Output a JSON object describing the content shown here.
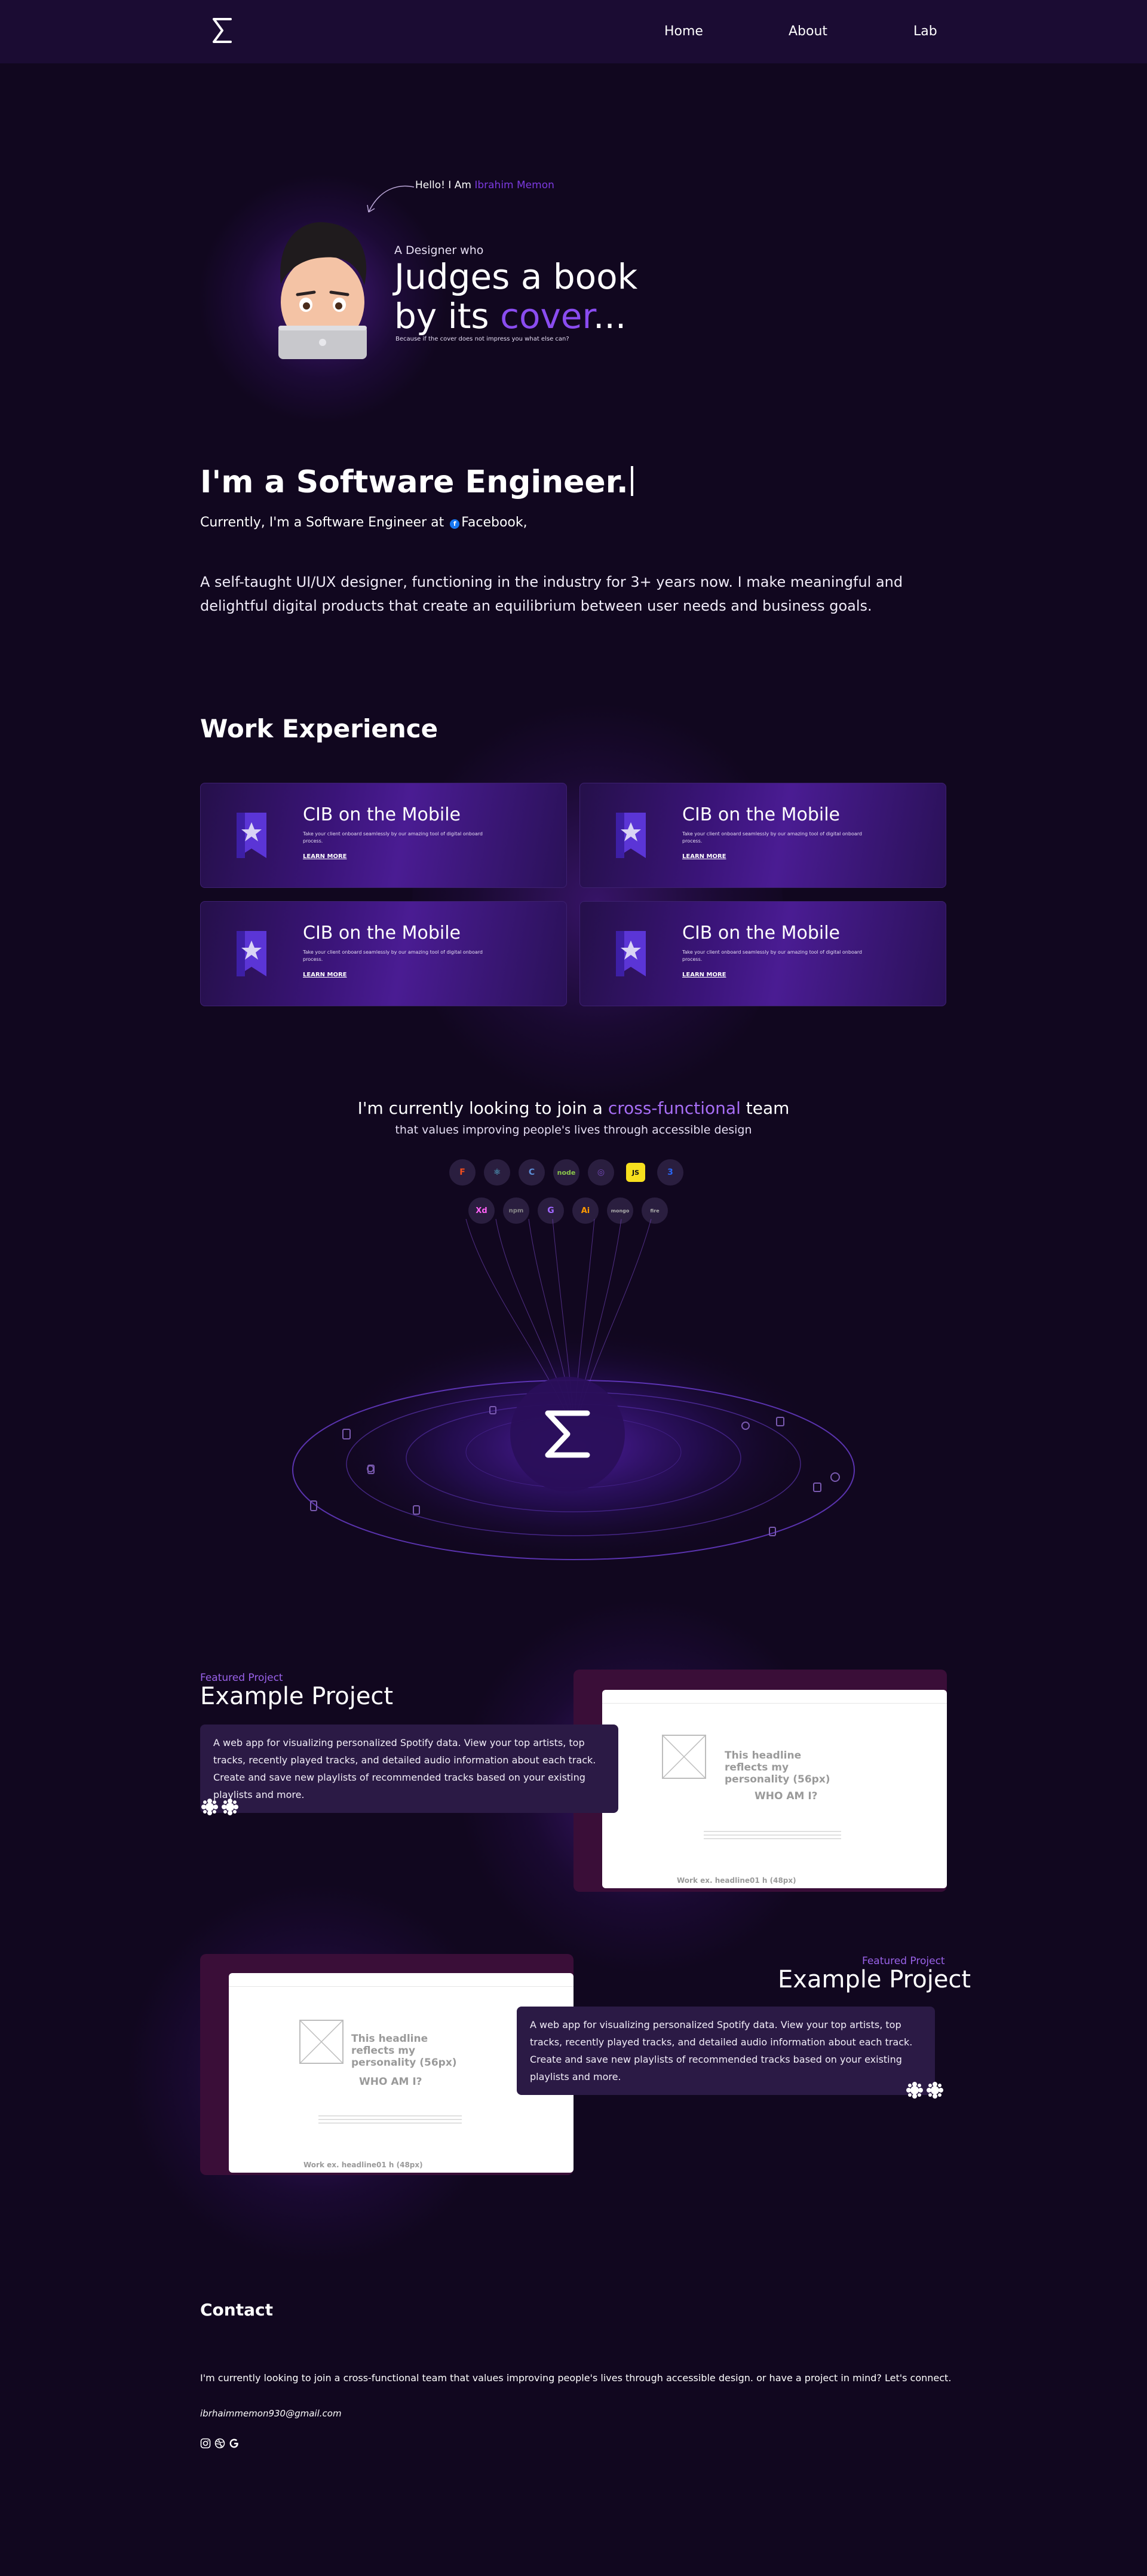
{
  "nav": {
    "links": [
      "Home",
      "About",
      "Lab"
    ]
  },
  "hero": {
    "hello_prefix": "Hello! I Am ",
    "hello_name": "Ibrahim Memon",
    "designer_line": "A Designer who",
    "headline_1": "Judges a book",
    "headline_2_prefix": "by its ",
    "headline_2_highlight": "cover",
    "headline_2_suffix": "...",
    "because": "Because if the cover does not impress you what else can?"
  },
  "intro": {
    "title": "I'm a Software Engineer.",
    "current_prefix": "Currently, I'm a Software Engineer at ",
    "current_company": "Facebook,",
    "bio": "A self-taught UI/UX designer, functioning in the industry for 3+ years now. I make meaningful and delightful digital products that create an equilibrium between user needs and business goals."
  },
  "work": {
    "title": "Work Experience",
    "cards": [
      {
        "title": "CIB on the Mobile",
        "desc": "Take your client onboard seamlessly by our amazing tool of digital onboard process.",
        "link": "LEARN MORE"
      },
      {
        "title": "CIB on the Mobile",
        "desc": "Take your client onboard seamlessly by our amazing tool of digital onboard process.",
        "link": "LEARN MORE"
      },
      {
        "title": "CIB on the Mobile",
        "desc": "Take your client onboard seamlessly by our amazing tool of digital onboard process.",
        "link": "LEARN MORE"
      },
      {
        "title": "CIB on the Mobile",
        "desc": "Take your client onboard seamlessly by our amazing tool of digital onboard process.",
        "link": "LEARN MORE"
      }
    ]
  },
  "skills": {
    "title_prefix": "I'm currently looking to join a ",
    "title_highlight": "cross-functional",
    "title_suffix": " team",
    "subtitle": "that values improving people's lives through accessible design",
    "row1": [
      {
        "icon": "figma-icon",
        "label": "F",
        "color": "#f24e1e"
      },
      {
        "icon": "react-icon",
        "label": "⚛",
        "color": "#61dafb"
      },
      {
        "icon": "c-icon",
        "label": "C",
        "color": "#5c8dd6"
      },
      {
        "icon": "node-icon",
        "label": "node",
        "color": "#8cc84b"
      },
      {
        "icon": "redux-icon",
        "label": "◎",
        "color": "#764abc"
      },
      {
        "icon": "js-icon",
        "label": "JS",
        "color": "#f7df1e"
      },
      {
        "icon": "css-icon",
        "label": "3",
        "color": "#2965f1"
      }
    ],
    "row2": [
      {
        "icon": "xd-icon",
        "label": "Xd",
        "color": "#ff61f6"
      },
      {
        "icon": "npm-icon",
        "label": "npm",
        "color": "#8a8a8a"
      },
      {
        "icon": "gatsby-icon",
        "label": "G",
        "color": "#a066ff"
      },
      {
        "icon": "illustrator-icon",
        "label": "Ai",
        "color": "#ff9a00"
      },
      {
        "icon": "mongodb-icon",
        "label": "mongo",
        "color": "#aaaaaa"
      },
      {
        "icon": "firebase-icon",
        "label": "fire",
        "color": "#aaaaaa"
      }
    ]
  },
  "projects": [
    {
      "featured": "Featured Project",
      "title": "Example Project",
      "desc": "A web app for visualizing personalized Spotify data. View your top artists, top tracks, recently played tracks, and detailed audio information about each track. Create and save new playlists of recommended tracks based on your existing playlists and more.",
      "shot": {
        "headline": "This headline reflects my personality (56px)",
        "who": "WHO AM I?",
        "work": "Work ex. headline01 h (48px)"
      }
    },
    {
      "featured": "Featured Project",
      "title": "Example Project",
      "desc": "A web app for visualizing personalized Spotify data. View your top artists, top tracks, recently played tracks, and detailed audio information about each track. Create and save new playlists of recommended tracks based on your existing playlists and more.",
      "shot": {
        "headline": "This headline reflects my personality (56px)",
        "who": "WHO AM I?",
        "work": "Work ex. headline01 h (48px)"
      }
    }
  ],
  "contact": {
    "title": "Contact",
    "text": "I'm currently looking to join a cross-functional team that values improving people's lives through accessible design. or have a project in mind? Let's connect.",
    "email": "ibrhaimmemon930@gmail.com"
  },
  "colors": {
    "bg": "#11071f",
    "nav": "#1b0c33",
    "accent": "#8a4cf0",
    "card": "#3a1478"
  }
}
